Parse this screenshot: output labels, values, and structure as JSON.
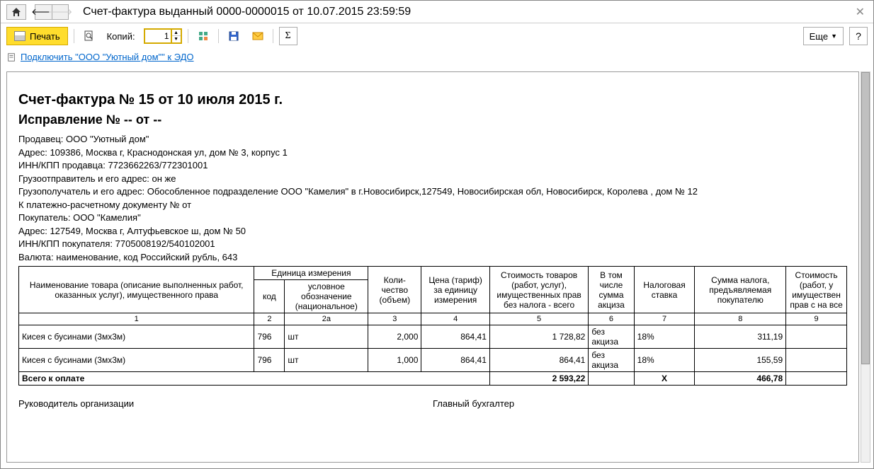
{
  "window": {
    "title": "Счет-фактура выданный 0000-0000015 от 10.07.2015 23:59:59"
  },
  "toolbar": {
    "print_label": "Печать",
    "copies_label": "Копий:",
    "copies_value": "1",
    "more_label": "Еще",
    "help_label": "?"
  },
  "edo": {
    "link_text": "Подключить \"ООО \"Уютный дом\"\" к ЭДО"
  },
  "document": {
    "heading": "Счет-фактура № 15 от 10 июля 2015 г.",
    "correction": "Исправление № -- от --",
    "seller": "Продавец: ООО \"Уютный дом\"",
    "seller_address": "Адрес: 109386, Москва г, Краснодонская ул, дом № 3, корпус 1",
    "seller_inn": "ИНН/КПП продавца: 7723662263/772301001",
    "shipper": "Грузоотправитель и его адрес: он же",
    "consignee": "Грузополучатель и его адрес: Обособленное подразделение ООО \"Камелия\" в г.Новосибирск,127549, Новосибирская обл, Новосибирск, Королева , дом № 12",
    "payment_doc": "К платежно-расчетному документу №     от",
    "buyer": "Покупатель: ООО \"Камелия\"",
    "buyer_address": "Адрес: 127549, Москва г, Алтуфьевское ш, дом № 50",
    "buyer_inn": "ИНН/КПП покупателя: 7705008192/540102001",
    "currency": "Валюта: наименование, код Российский рубль, 643",
    "signatures": {
      "director": "Руководитель организации",
      "accountant": "Главный бухгалтер"
    }
  },
  "table": {
    "headers": {
      "name": "Наименование товара (описание выполненных работ, оказанных услуг), имущественного права",
      "unit": "Единица измерения",
      "unit_code": "код",
      "unit_symbol": "условное обозначение (национальное)",
      "qty": "Коли-чество (объем)",
      "price": "Цена (тариф) за единицу измерения",
      "cost_no_tax": "Стоимость товаров (работ, услуг), имущественных прав без налога - всего",
      "excise": "В том числе сумма акциза",
      "tax_rate": "Налоговая ставка",
      "tax_amount": "Сумма налога, предъявляемая покупателю",
      "cost_with_tax": "Стоимость (работ, у имуществен прав с на все"
    },
    "col_nums": {
      "c1": "1",
      "c2": "2",
      "c2a": "2а",
      "c3": "3",
      "c4": "4",
      "c5": "5",
      "c6": "6",
      "c7": "7",
      "c8": "8",
      "c9": "9"
    },
    "rows": [
      {
        "name": "Кисея с бусинами (3мх3м)",
        "unit_code": "796",
        "unit_symbol": "шт",
        "qty": "2,000",
        "price": "864,41",
        "cost_no_tax": "1 728,82",
        "excise": "без акциза",
        "tax_rate": "18%",
        "tax_amount": "311,19"
      },
      {
        "name": "Кисея с бусинами (3мх3м)",
        "unit_code": "796",
        "unit_symbol": "шт",
        "qty": "1,000",
        "price": "864,41",
        "cost_no_tax": "864,41",
        "excise": "без акциза",
        "tax_rate": "18%",
        "tax_amount": "155,59"
      }
    ],
    "total": {
      "label": "Всего к оплате",
      "cost_no_tax": "2 593,22",
      "tax_rate": "Х",
      "tax_amount": "466,78"
    }
  }
}
